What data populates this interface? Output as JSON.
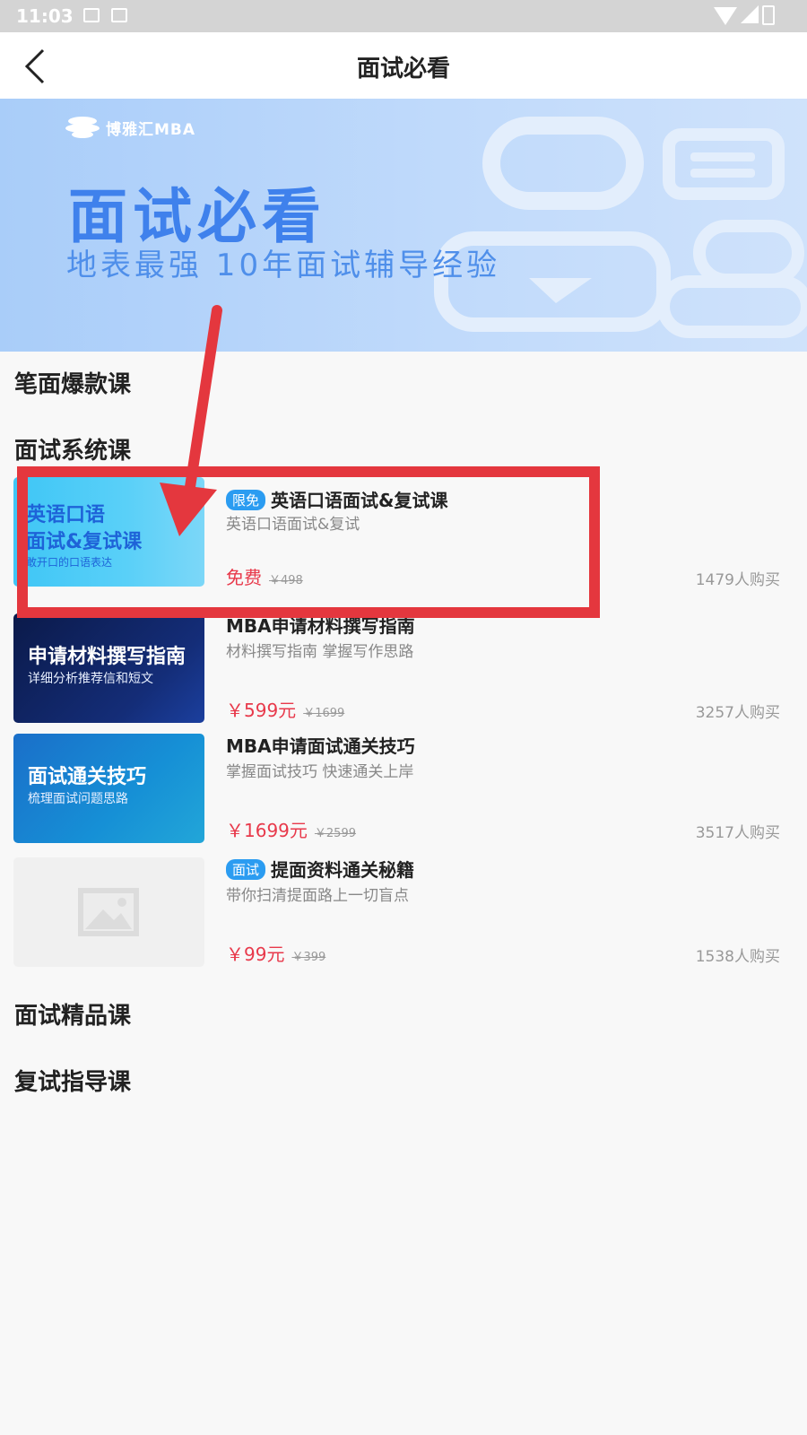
{
  "status_bar": {
    "time": "11:03"
  },
  "header": {
    "title": "面试必看"
  },
  "banner": {
    "logo_text": "博雅汇MBA",
    "headline": "面试必看",
    "subline": "地表最强  10年面试辅导经验"
  },
  "sections": {
    "s1": "笔面爆款课",
    "s2": "面试系统课",
    "s3": "面试精品课",
    "s4": "复试指导课"
  },
  "courses": [
    {
      "tag": "限免",
      "title": "英语口语面试&复试课",
      "subtitle": "英语口语面试&复试",
      "price": "免费",
      "original_price": "￥498",
      "buyers": "1479人购买",
      "thumb_line1": "英语口语",
      "thumb_line2": "面试&复试课",
      "thumb_line3": "敢开口的口语表达"
    },
    {
      "title": "MBA申请材料撰写指南",
      "subtitle": "材料撰写指南  掌握写作思路",
      "price": "￥599元",
      "original_price": "￥1699",
      "buyers": "3257人购买",
      "thumb_line1": "申请材料撰写指南",
      "thumb_line2": "详细分析推荐信和短文"
    },
    {
      "title": "MBA申请面试通关技巧",
      "subtitle": "掌握面试技巧  快速通关上岸",
      "price": "￥1699元",
      "original_price": "￥2599",
      "buyers": "3517人购买",
      "thumb_line1": "面试通关技巧",
      "thumb_line2": "梳理面试问题思路"
    },
    {
      "tag": "面试",
      "title": "提面资料通关秘籍",
      "subtitle": "带你扫清提面路上一切盲点",
      "price": "￥99元",
      "original_price": "￥399",
      "buyers": "1538人购买"
    }
  ],
  "colors": {
    "accent": "#2b9cf1",
    "price": "#e8394b",
    "annotation": "#e4373e",
    "banner_text": "#3f81ec"
  }
}
